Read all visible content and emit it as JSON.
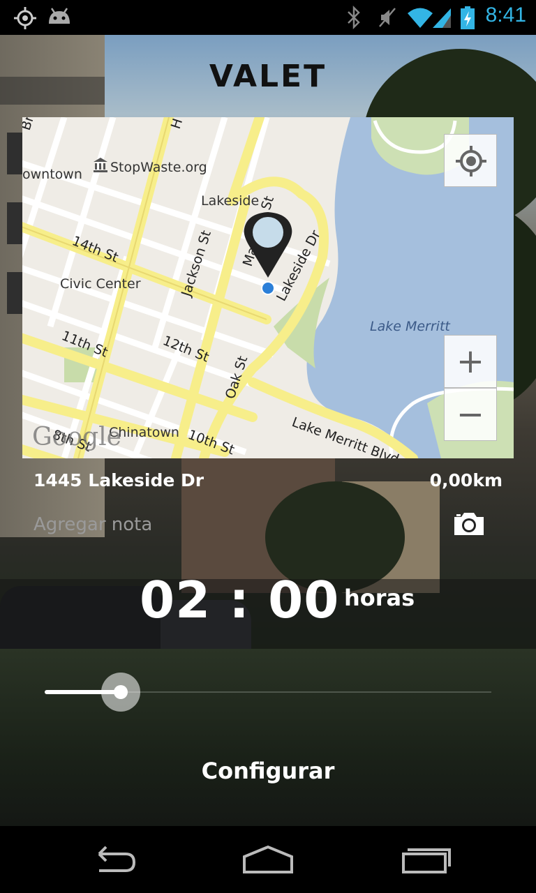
{
  "status_bar": {
    "time": "8:41",
    "left_icons": [
      "gps-icon",
      "android-debug-icon"
    ],
    "right_icons": [
      "bluetooth-icon",
      "vibrate-off-icon",
      "wifi-icon",
      "signal-icon",
      "battery-charging-icon"
    ],
    "accent": "#33b5e5"
  },
  "app": {
    "title": "VALET"
  },
  "map": {
    "labels": {
      "lakeside": "Lakeside",
      "downtown": "owntown",
      "stopwaste": "StopWaste.org",
      "civic_center": "Civic Center",
      "lake_merritt": "Lake Merritt",
      "chinatown": "Chinatown",
      "st_14": "14th St",
      "st_12": "12th St",
      "st_11": "11th St",
      "st_10": "10th St",
      "st_8": "8th St",
      "jackson": "Jackson St",
      "madison": "Madison St",
      "lakeside_dr": "Lakeside Dr",
      "oak": "Oak St",
      "lake_merritt_blvd": "Lake Merritt Blvd",
      "br": "Br",
      "h": "H"
    },
    "logo": "Google",
    "zoom_in_label": "+",
    "zoom_out_label": "−"
  },
  "parking": {
    "address": "1445 Lakeside Dr",
    "distance": "0,00km",
    "note_placeholder": "Agregar nota",
    "timer": "02 : 00",
    "timer_unit": "horas",
    "slider_fraction": 0.17,
    "config_label": "Configurar"
  },
  "nav_bar": {
    "icons": [
      "back-icon",
      "home-icon",
      "recent-apps-icon"
    ]
  }
}
